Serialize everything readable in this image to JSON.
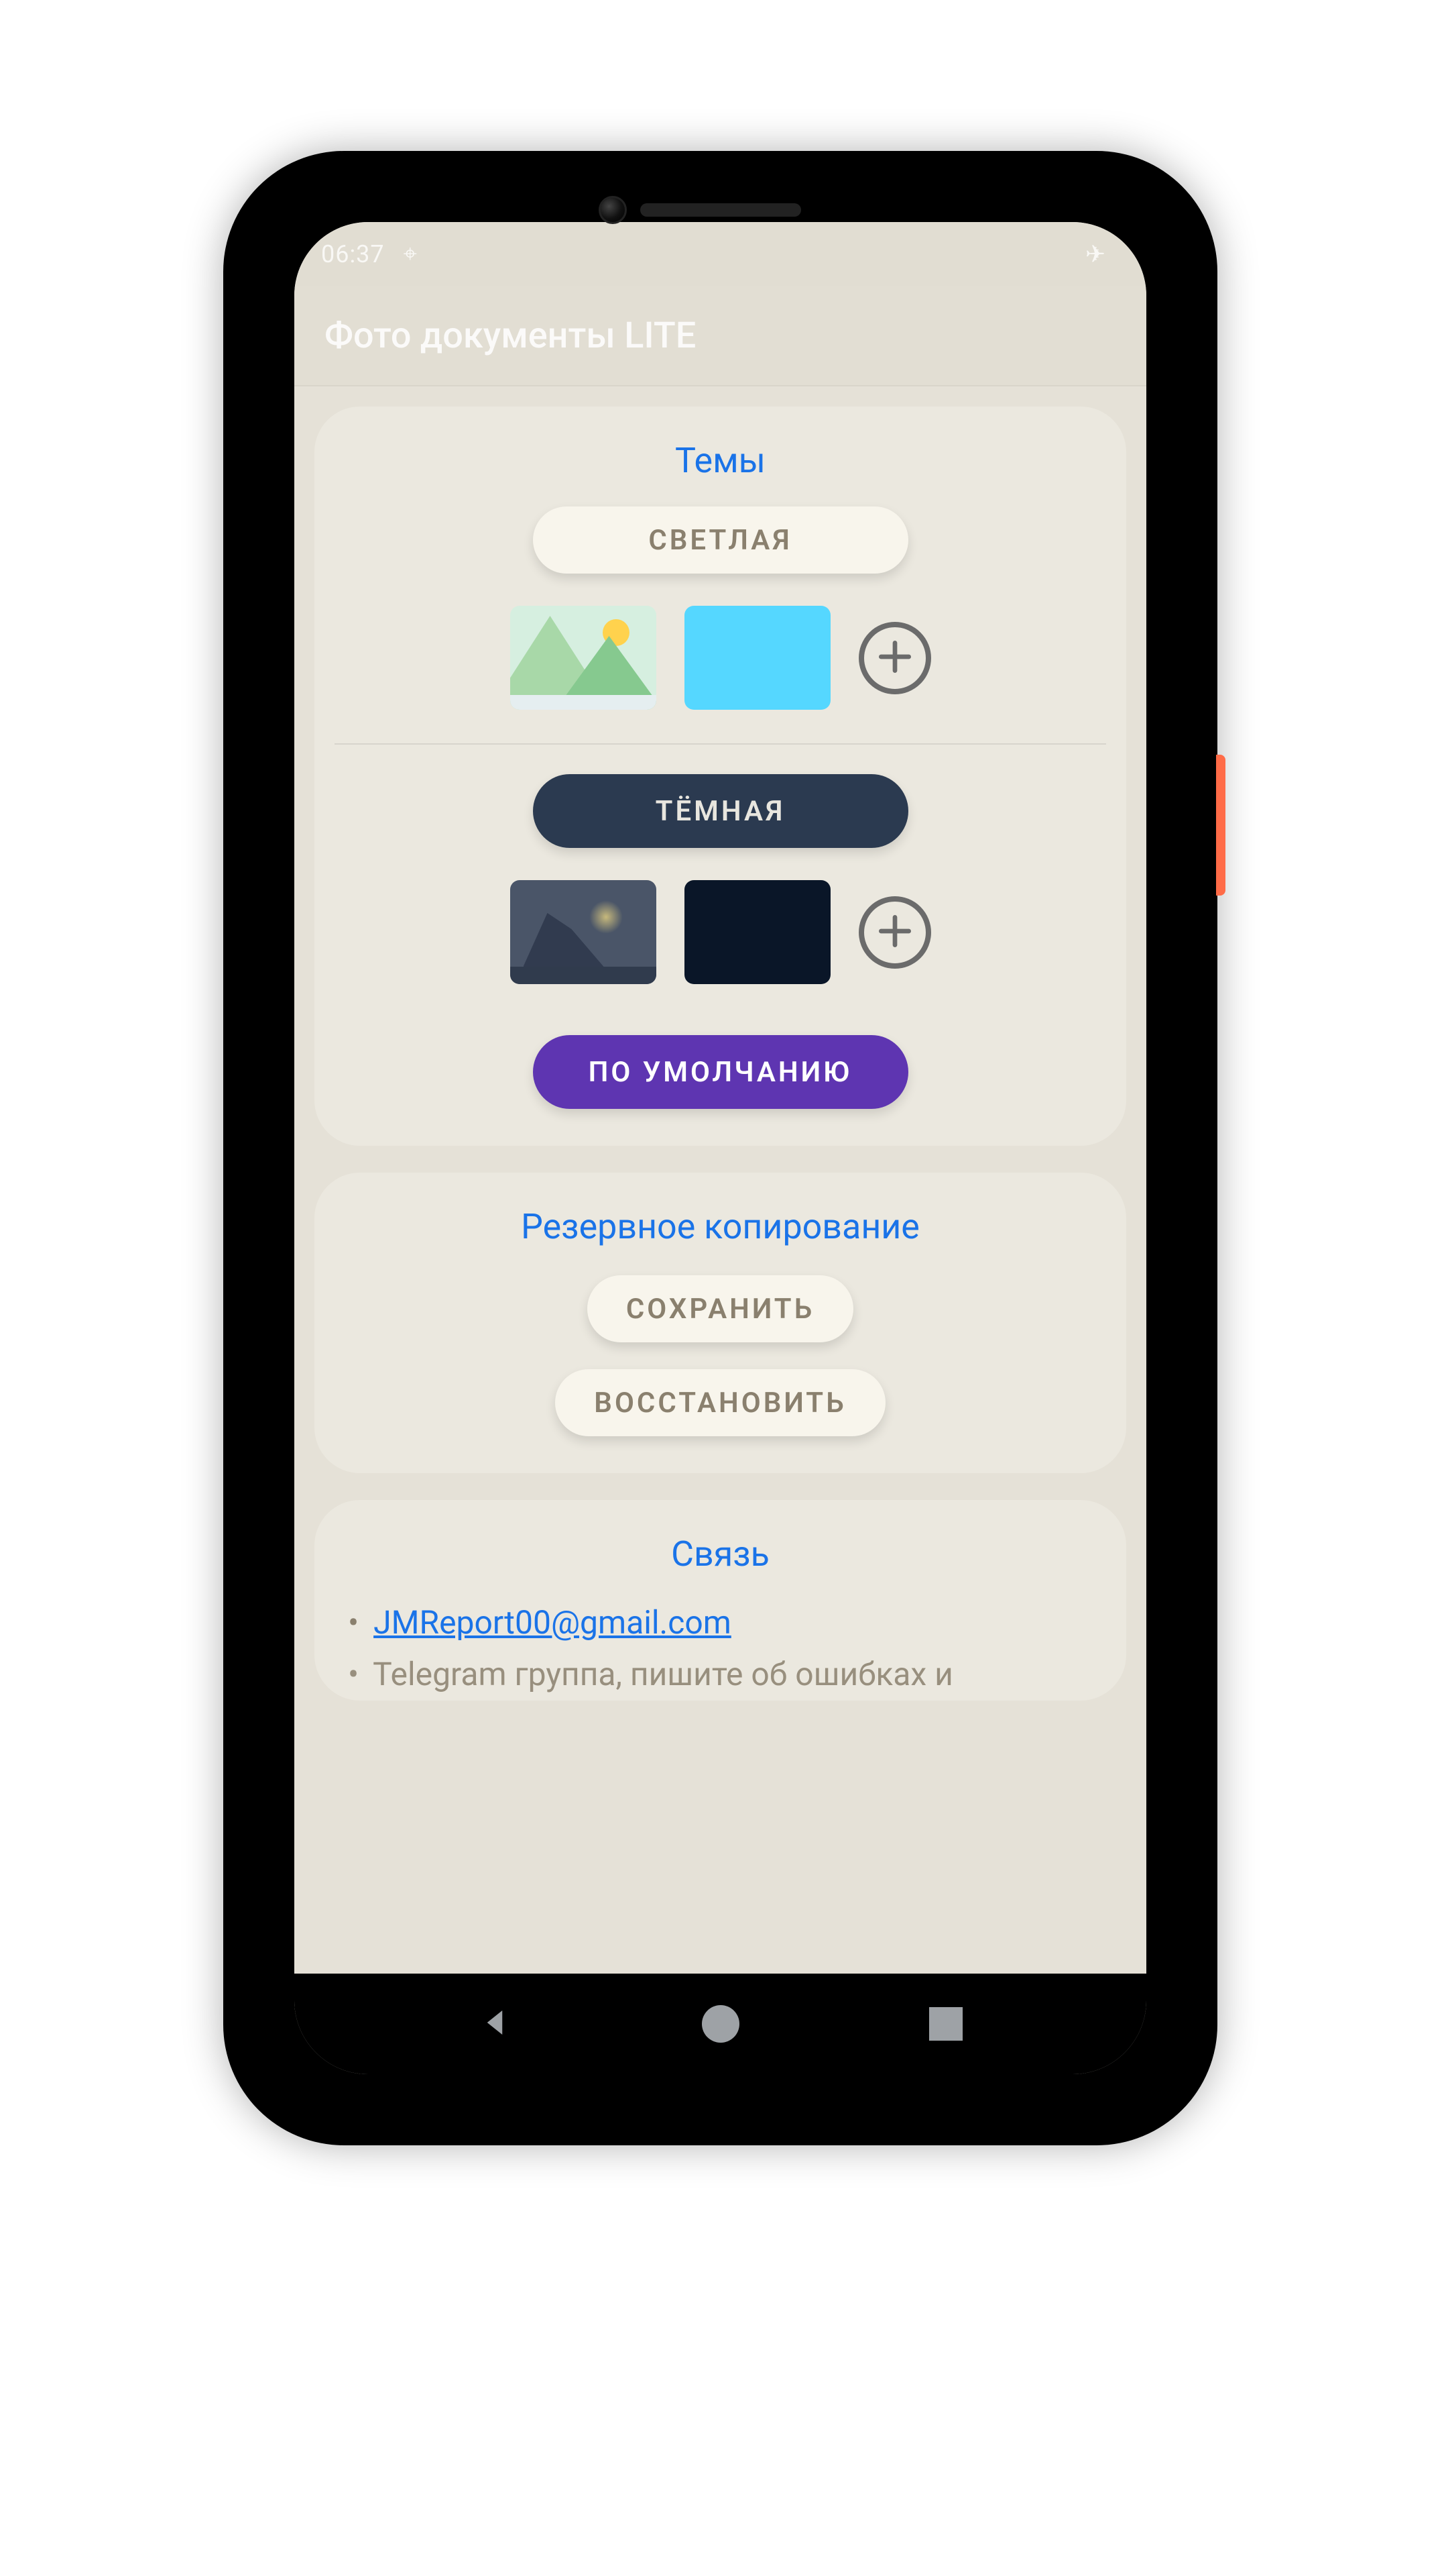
{
  "status": {
    "time": "06:37",
    "icons": {
      "location": "⌖",
      "airplane": "✈"
    }
  },
  "app": {
    "title": "Фото документы LITE"
  },
  "themes": {
    "heading": "Темы",
    "light_label": "СВЕТЛАЯ",
    "dark_label": "ТЁМНАЯ",
    "default_label": "ПО УМОЛЧАНИЮ",
    "light_preview_color": "#55d7ff",
    "dark_preview_color": "#0a1628"
  },
  "backup": {
    "heading": "Резервное копирование",
    "save_label": "СОХРАНИТЬ",
    "restore_label": "ВОССТАНОВИТЬ"
  },
  "contact": {
    "heading": "Связь",
    "email": "JMReport00@gmail.com",
    "telegram_partial": "Telegram группа, пишите об ошибках и"
  },
  "colors": {
    "accent": "#1a73e8",
    "primary": "#5e35b1",
    "dark_pill": "#2b3a50",
    "surface": "#ebe8df",
    "background": "#e5e1d7",
    "cream_button": "#f8f5ec",
    "muted_text": "#8a806e"
  }
}
